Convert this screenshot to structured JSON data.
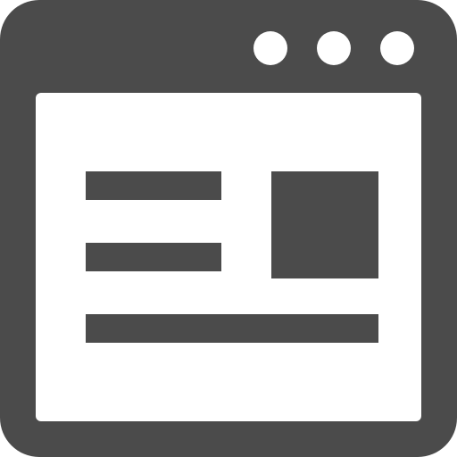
{
  "icon": {
    "semantic": "browser-window-icon",
    "frame_color": "#4b4b4b",
    "background_color": "#ffffff",
    "titlebar_dots": [
      "window-dot-icon",
      "window-dot-icon",
      "window-dot-icon"
    ],
    "content_blocks": [
      "text-line",
      "text-line",
      "text-line",
      "image-placeholder"
    ]
  }
}
